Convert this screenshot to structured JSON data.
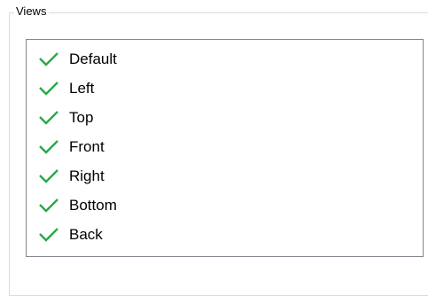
{
  "groupbox": {
    "title": "Views"
  },
  "views_list": {
    "check_color": "#2aa84a",
    "items": [
      {
        "label": "Default",
        "checked": true
      },
      {
        "label": "Left",
        "checked": true
      },
      {
        "label": "Top",
        "checked": true
      },
      {
        "label": "Front",
        "checked": true
      },
      {
        "label": "Right",
        "checked": true
      },
      {
        "label": "Bottom",
        "checked": true
      },
      {
        "label": "Back",
        "checked": true
      }
    ]
  }
}
